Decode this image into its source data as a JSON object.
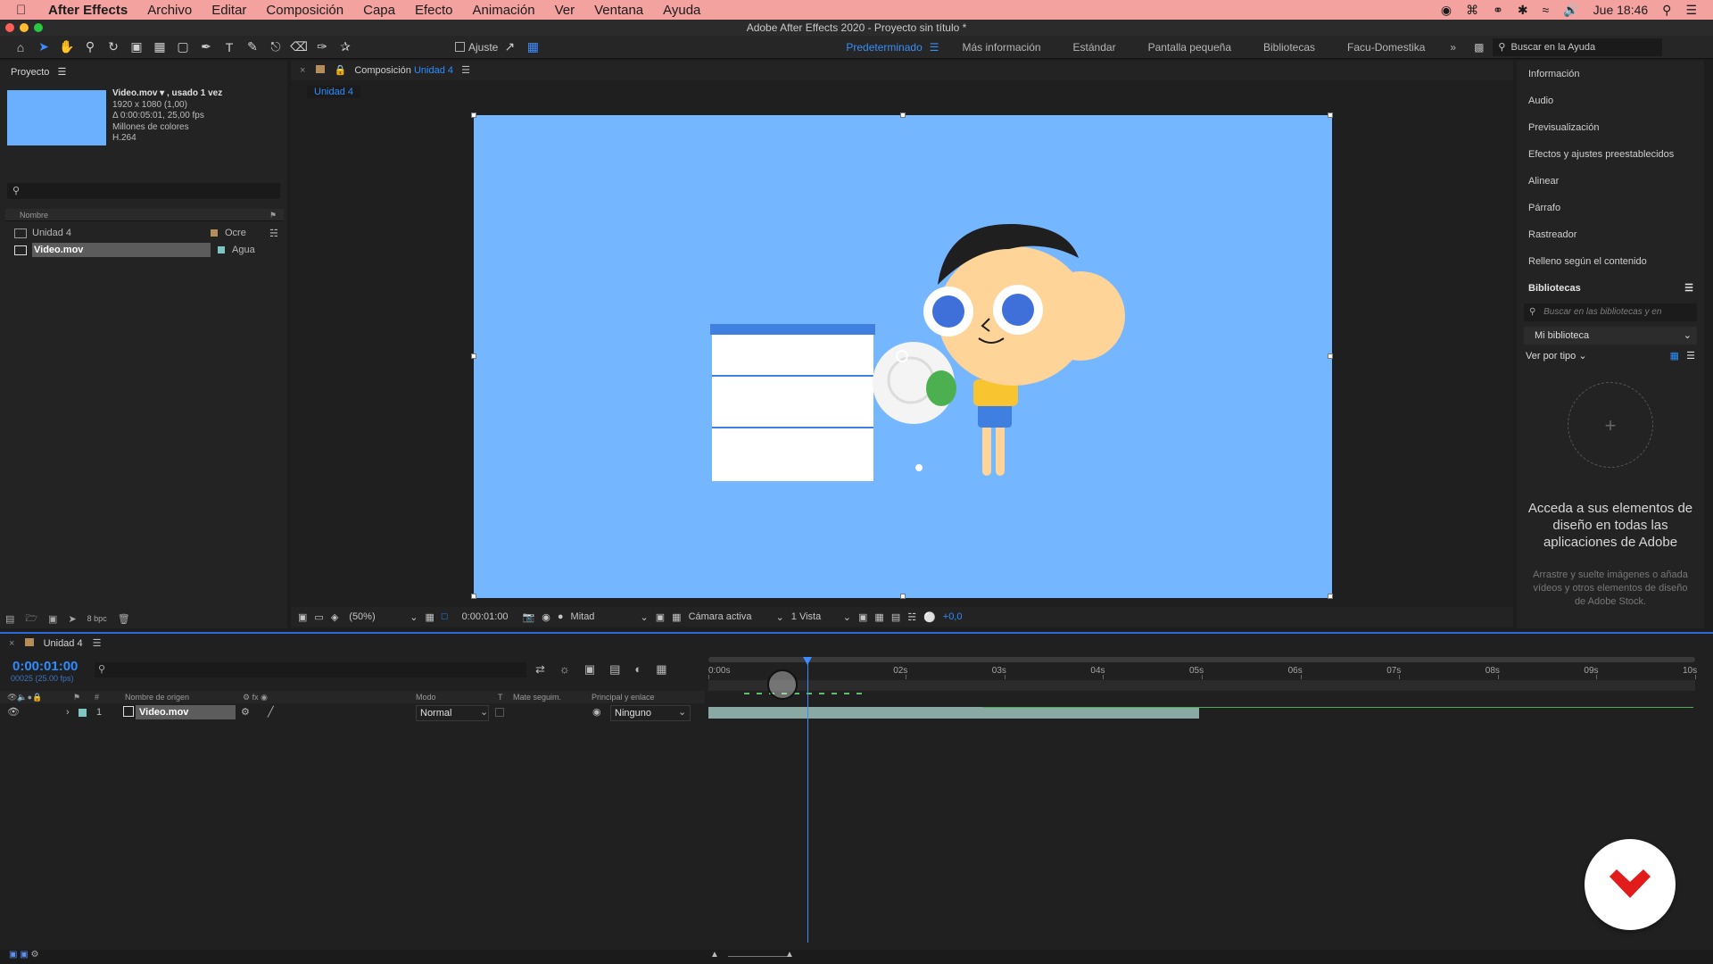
{
  "menubar": {
    "app": "After Effects",
    "items": [
      "Archivo",
      "Editar",
      "Composición",
      "Capa",
      "Efecto",
      "Animación",
      "Ver",
      "Ventana",
      "Ayuda"
    ],
    "clock": "Jue 18:46"
  },
  "window": {
    "title": "Adobe After Effects 2020 - Proyecto sin título *"
  },
  "toolbar": {
    "snap_label": "Ajuste",
    "workspaces": [
      "Predeterminado",
      "Más información",
      "Estándar",
      "Pantalla pequeña",
      "Bibliotecas",
      "Facu-Domestika"
    ],
    "help_placeholder": "Buscar en la Ayuda"
  },
  "project": {
    "title": "Proyecto",
    "item_name": "Video.mov ▾ , usado 1 vez",
    "meta": [
      "1920 x 1080 (1,00)",
      "Δ 0:00:05:01, 25,00 fps",
      "Millones de colores",
      "H.264"
    ],
    "col_name": "Nombre",
    "items": [
      {
        "name": "Unidad 4",
        "label": "Ocre",
        "color": "#b58d5a"
      },
      {
        "name": "Video.mov",
        "label": "Agua",
        "color": "#7fc6c3"
      }
    ],
    "bpc": "8 bpc"
  },
  "comp": {
    "tab_prefix": "Composición",
    "tab_name": "Unidad 4",
    "sub_tab": "Unidad 4",
    "zoom": "(50%)",
    "timecode": "0:00:01:00",
    "resolution": "Mitad",
    "camera": "Cámara activa",
    "views": "1 Vista",
    "exposure": "+0,0"
  },
  "right_panel": {
    "items": [
      "Información",
      "Audio",
      "Previsualización",
      "Efectos y ajustes preestablecidos",
      "Alinear",
      "Párrafo",
      "Rastreador",
      "Relleno según el contenido"
    ],
    "libraries_title": "Bibliotecas",
    "lib_search_placeholder": "Buscar en las bibliotecas y en",
    "lib_select": "Mi biblioteca",
    "view_by": "Ver por tipo",
    "heading": "Acceda a sus elementos de diseño en todas las aplicaciones de Adobe",
    "hint": "Arrastre y suelte imágenes o añada vídeos y otros elementos de diseño de Adobe Stock."
  },
  "timeline": {
    "tab": "Unidad 4",
    "current_time": "0:00:01:00",
    "frame_info": "00025 (25.00 fps)",
    "col_source": "Nombre de origen",
    "col_mode": "Modo",
    "col_t": "T",
    "col_matte": "Mate seguim.",
    "col_parent": "Principal y enlace",
    "layer": {
      "index": "1",
      "name": "Video.mov",
      "mode": "Normal",
      "parent": "Ninguno"
    },
    "ticks": [
      "0:00s",
      "02s",
      "03s",
      "04s",
      "05s",
      "06s",
      "07s",
      "08s",
      "09s",
      "10s"
    ],
    "playhead_sec": 1.0,
    "layer_end_sec": 5.04
  },
  "colors": {
    "accent": "#2d8cff",
    "canvas_bg": "#74b6ff",
    "layer_bar": "#8aa8a4",
    "logo_red": "#e21b1b"
  }
}
